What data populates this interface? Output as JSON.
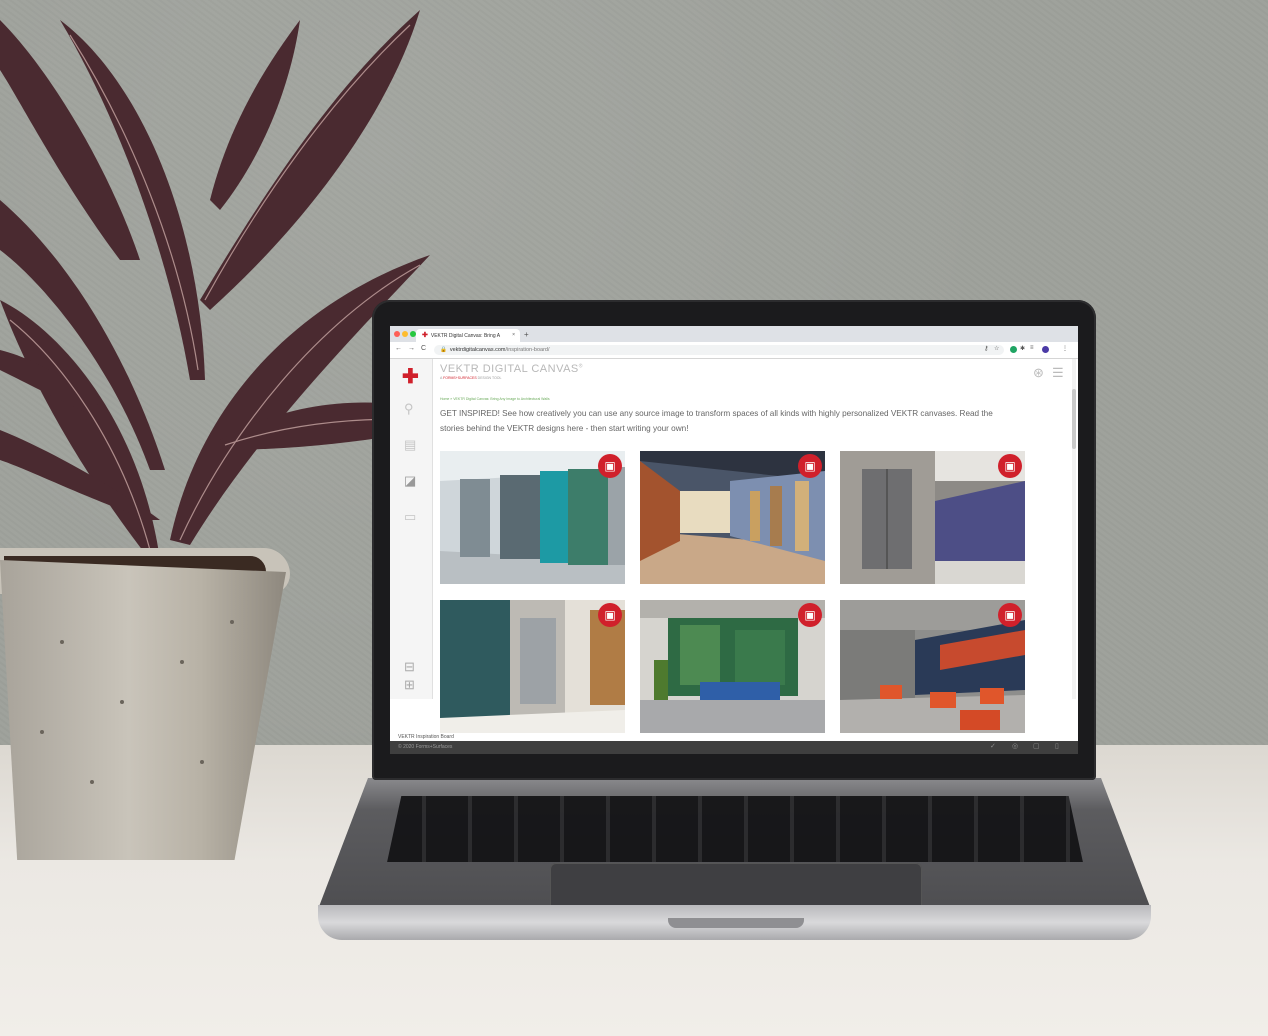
{
  "browser": {
    "tab_title": "VEKTR Digital Canvas: Bring A",
    "tab_close": "×",
    "new_tab": "+",
    "url_host": "vektrdigitalcanvas.com",
    "url_path": "/inspiration-board/",
    "back": "←",
    "forward": "→",
    "reload": "C"
  },
  "app": {
    "brand_title": "VEKTR DIGITAL CANVAS",
    "brand_trademark": "®",
    "brand_sub_prefix": "A ",
    "brand_sub_company": "FORMS+SURFACES",
    "brand_sub_suffix": " DESIGN TOOL",
    "breadcrumb": "Home » VEKTR Digital Canvas: Bring Any Image to Architectural Walls",
    "intro_text": "GET INSPIRED! See how creatively you can use any source image to transform spaces of all kinds with highly personalized VEKTR canvases. Read the stories behind the VEKTR designs here - then start writing your own!",
    "status_label": "VEKTR Inspiration Board",
    "footer_copyright": "© 2020 Forms+Surfaces"
  },
  "colors": {
    "brand_red": "#d0202b",
    "breadcrumb_green": "#6aaa5a"
  },
  "icons": {
    "film": "film-icon",
    "login": "login-icon",
    "menu": "hamburger-menu-icon"
  }
}
